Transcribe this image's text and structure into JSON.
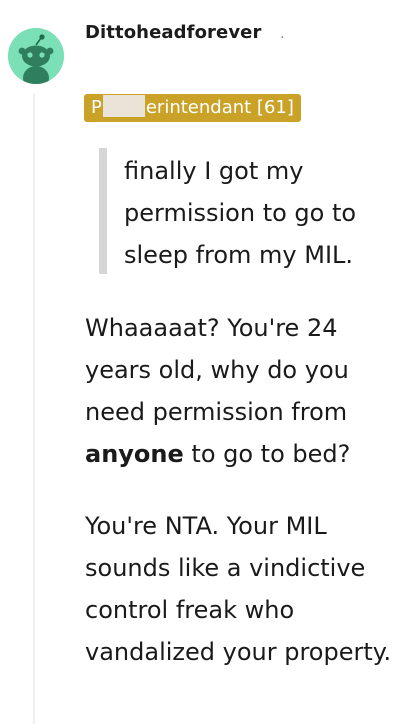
{
  "comment": {
    "username": "Dittoheadforever",
    "separator": "·",
    "flair": {
      "prefix": "P",
      "suffix": "erintendant [61]"
    },
    "quote": "finally I got my permission to go to sleep from my MIL.",
    "paragraph1": {
      "before": "Whaaaaat? You're 24 years old, why do you need permission from ",
      "bold": "anyone",
      "after": " to go to bed?"
    },
    "paragraph2": "You're NTA. Your MIL sounds like a vindictive control freak who vandalized your property."
  },
  "colors": {
    "avatar_bg": "#7be0b5",
    "flair_bg": "#c9a227",
    "thread_line": "#edeff1",
    "quote_bar": "#d6d6d6"
  },
  "icons": {
    "avatar": "snoo-avatar-icon"
  }
}
